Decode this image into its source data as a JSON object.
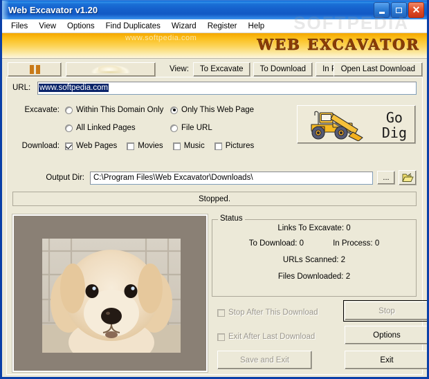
{
  "window": {
    "title": "Web Excavator v1.20",
    "minimize_label": "Minimize",
    "maximize_label": "Maximize",
    "close_label": "Close",
    "title_gradient_start": "#0b61d6",
    "title_gradient_end": "#1259c4",
    "close_color": "#e2502a"
  },
  "watermarks": {
    "menu": "SOFTPEDIA",
    "banner": "www.softpedia.com"
  },
  "menubar": {
    "items": [
      {
        "label": "Files"
      },
      {
        "label": "View"
      },
      {
        "label": "Options"
      },
      {
        "label": "Find Duplicates"
      },
      {
        "label": "Wizard"
      },
      {
        "label": "Register"
      },
      {
        "label": "Help"
      }
    ]
  },
  "banner": {
    "title": "WEB EXCAVATOR",
    "accent_color": "#8a3b06",
    "background_start": "#f5a800",
    "background_end": "#fdf6df"
  },
  "toolbar": {
    "pause_button": "pause-icon",
    "dirt_button": "dirt-pile-icon",
    "view_label": "View:",
    "view_buttons": [
      {
        "label": "To Excavate"
      },
      {
        "label": "To Download"
      },
      {
        "label": "In Process"
      }
    ],
    "open_last_download": "Open Last Download"
  },
  "url_row": {
    "label": "URL:",
    "value": "www.softpedia.com",
    "selected": true
  },
  "excavate": {
    "label": "Excavate:",
    "options": [
      {
        "label": "Within This Domain Only",
        "selected": false
      },
      {
        "label": "Only This Web Page",
        "selected": true
      },
      {
        "label": "All Linked Pages",
        "selected": false
      },
      {
        "label": "File URL",
        "selected": false
      }
    ]
  },
  "download": {
    "label": "Download:",
    "options": [
      {
        "label": "Web Pages",
        "checked": true
      },
      {
        "label": "Movies",
        "checked": false
      },
      {
        "label": "Music",
        "checked": false
      },
      {
        "label": "Pictures",
        "checked": false
      }
    ]
  },
  "go_dig": {
    "line1": "Go",
    "line2": "Dig",
    "icon": "excavator-icon"
  },
  "output_dir": {
    "label": "Output Dir:",
    "value": "C:\\Program Files\\Web Excavator\\Downloads\\",
    "browse_button": "...",
    "folder_button": "open-folder-icon"
  },
  "status_strip": {
    "text": "Stopped."
  },
  "preview": {
    "name": "downloaded-image-preview",
    "alt": "golden retriever puppy photo"
  },
  "status_group": {
    "title": "Status",
    "links_to_excavate_label": "Links To Excavate:",
    "links_to_excavate_value": "0",
    "to_download_label": "To Download:",
    "to_download_value": "0",
    "in_process_label": "In Process:",
    "in_process_value": "0",
    "urls_scanned_label": "URLs Scanned:",
    "urls_scanned_value": "2",
    "files_downloaded_label": "Files Downloaded:",
    "files_downloaded_value": "2"
  },
  "bottom": {
    "stop_after_this_download": {
      "label": "Stop After This Download",
      "checked": false,
      "enabled": false
    },
    "exit_after_last_download": {
      "label": "Exit After Last Download",
      "checked": false,
      "enabled": false
    },
    "save_and_exit": {
      "label": "Save and Exit",
      "enabled": false
    },
    "stop": {
      "label": "Stop",
      "enabled": false,
      "default": true
    },
    "options": {
      "label": "Options",
      "enabled": true
    },
    "exit": {
      "label": "Exit",
      "enabled": true
    }
  }
}
